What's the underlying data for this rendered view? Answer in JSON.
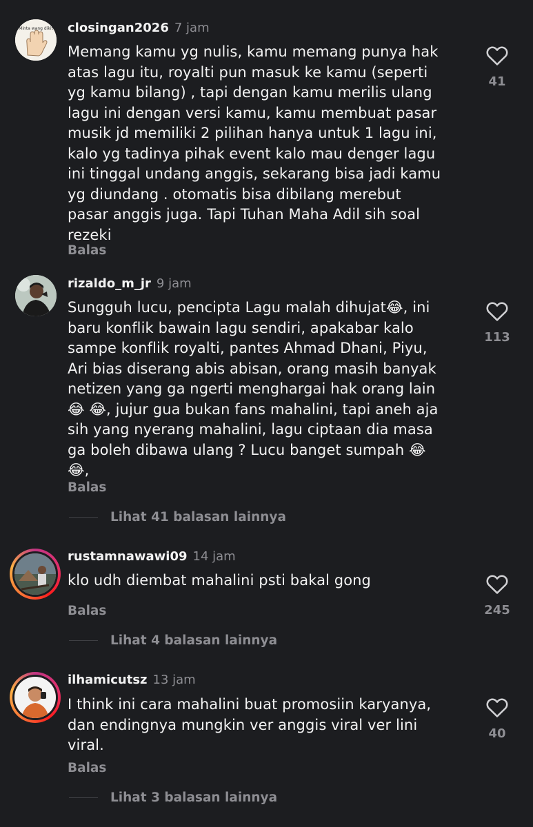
{
  "comments": [
    {
      "username": "closingan2026",
      "time": "7 jam",
      "avatar_text": "Minta wang dikit",
      "text": "Memang kamu yg nulis, kamu memang punya hak\natas lagu itu, royalti pun masuk ke kamu (seperti\nyg kamu bilang) , tapi dengan kamu merilis ulang\nlagu ini dengan versi kamu, kamu membuat pasar\nmusik jd memiliki 2 pilihan hanya untuk 1 lagu ini,\nkalo yg tadinya pihak event kalo mau denger lagu\nini tinggal undang anggis, sekarang bisa jadi kamu\nyg diundang . otomatis bisa dibilang merebut\npasar anggis juga. Tapi Tuhan Maha Adil sih soal\nrezeki",
      "reply_label": "Balas",
      "likes": "41"
    },
    {
      "username": "rizaldo_m_jr",
      "time": "9 jam",
      "text": "Sungguh lucu, pencipta Lagu malah dihujat😂, ini\nbaru konflik bawain lagu sendiri, apakabar kalo\nsampe konflik royalti, pantes Ahmad Dhani, Piyu,\nAri bias diserang abis abisan, orang masih banyak\nnetizen yang ga ngerti menghargai hak orang lain\n😂 😂, jujur gua bukan fans mahalini, tapi aneh aja\nsih yang nyerang mahalini, lagu ciptaan dia masa\nga boleh dibawa ulang ? Lucu banget sumpah 😂\n😂,",
      "reply_label": "Balas",
      "likes": "113",
      "view_replies": "Lihat 41 balasan lainnya"
    },
    {
      "username": "rustamnawawi09",
      "time": "14 jam",
      "text": "klo udh diembat mahalini psti bakal gong",
      "reply_label": "Balas",
      "likes": "245",
      "view_replies": "Lihat 4 balasan lainnya"
    },
    {
      "username": "ilhamicutsz",
      "time": "13 jam",
      "text": "I think ini cara mahalini buat promosiin karyanya,\ndan endingnya mungkin ver anggis viral ver lini\nviral.",
      "reply_label": "Balas",
      "likes": "40",
      "view_replies": "Lihat 3 balasan lainnya"
    }
  ],
  "icons": {
    "like": "heart-outline-icon"
  },
  "colors": {
    "background": "#1c1d20",
    "muted": "#8e8e93",
    "text": "#f2f2f2"
  }
}
